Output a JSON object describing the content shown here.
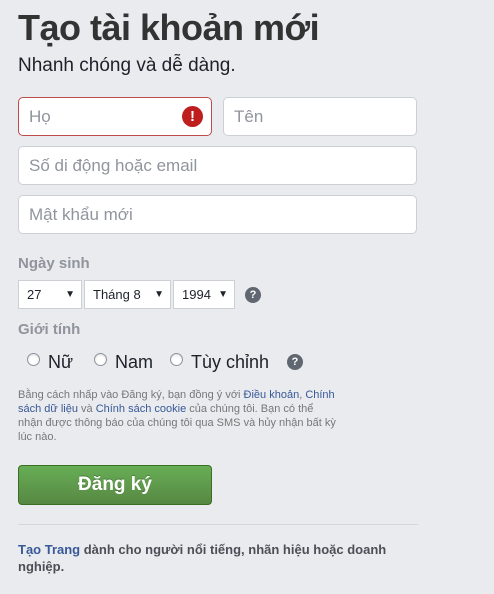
{
  "header": {
    "title": "Tạo tài khoản mới",
    "subtitle": "Nhanh chóng và dễ dàng."
  },
  "form": {
    "last_name": {
      "placeholder": "Họ",
      "value": "",
      "error": true
    },
    "first_name": {
      "placeholder": "Tên",
      "value": ""
    },
    "contact": {
      "placeholder": "Số di động hoặc email",
      "value": ""
    },
    "password": {
      "placeholder": "Mật khẩu mới",
      "value": ""
    }
  },
  "birthday": {
    "label": "Ngày sinh",
    "day": "27",
    "month": "Tháng 8",
    "year": "1994",
    "arrow": "▼",
    "help": "?"
  },
  "gender": {
    "label": "Giới tính",
    "options": [
      "Nữ",
      "Nam",
      "Tùy chỉnh"
    ],
    "help": "?"
  },
  "terms": {
    "part1": "Bằng cách nhấp vào Đăng ký, bạn đồng ý với ",
    "link_terms": "Điều khoản",
    "sep1": ", ",
    "link_data": "Chính sách dữ liệu",
    "sep2": " và ",
    "link_cookie": "Chính sách cookie",
    "part2": " của chúng tôi. Bạn có thể nhận được thông báo của chúng tôi qua SMS và hủy nhận bất kỳ lúc nào."
  },
  "signup_button": "Đăng ký",
  "footer": {
    "link": "Tạo Trang",
    "text": " dành cho người nổi tiếng, nhãn hiệu hoặc doanh nghiệp."
  },
  "colors": {
    "background": "#e9ebee",
    "error": "#be4b49",
    "button_green": "#69a74e",
    "link": "#385898"
  }
}
